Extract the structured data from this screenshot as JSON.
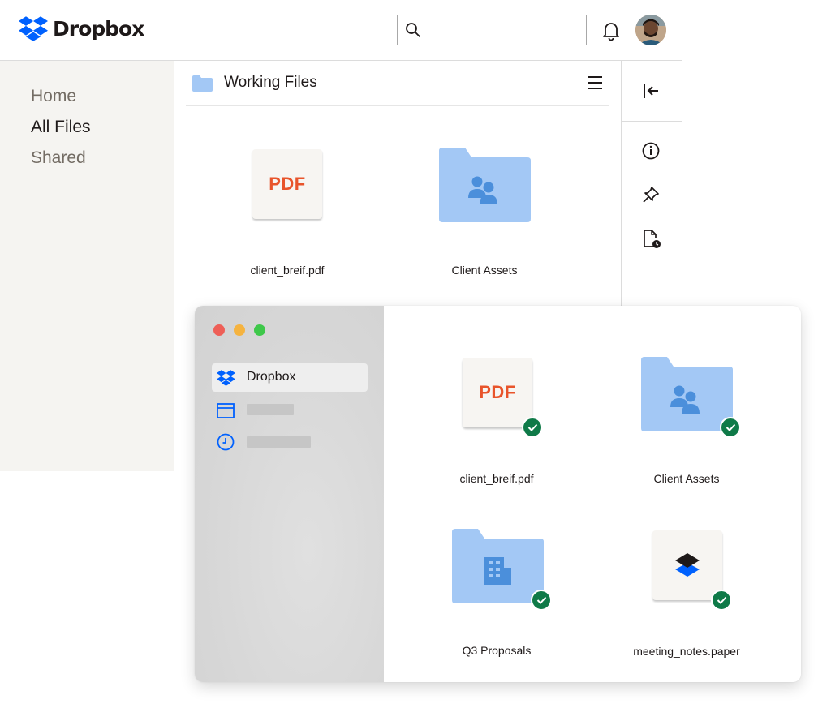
{
  "brand": {
    "name": "Dropbox",
    "color": "#0061fe"
  },
  "header": {
    "search_placeholder": "",
    "bell_icon": "bell-icon",
    "avatar_icon": "user-avatar"
  },
  "sidebar": {
    "items": [
      {
        "label": "Home",
        "active": false
      },
      {
        "label": "All Files",
        "active": true
      },
      {
        "label": "Shared",
        "active": false
      }
    ]
  },
  "main": {
    "folder_title": "Working Files",
    "files": [
      {
        "name": "client_breif.pdf",
        "badge": "PDF",
        "type": "pdf"
      },
      {
        "name": "Client Assets",
        "type": "shared-folder"
      }
    ]
  },
  "rail": {
    "icons": [
      "collapse-panel-icon",
      "info-icon",
      "pin-icon",
      "file-history-icon"
    ]
  },
  "desktop_window": {
    "traffic_lights": [
      "#ee5f57",
      "#f5b33f",
      "#3ec84a"
    ],
    "nav": {
      "active_label": "Dropbox"
    },
    "files": [
      {
        "name": "client_breif.pdf",
        "badge": "PDF",
        "type": "pdf",
        "synced": true
      },
      {
        "name": "Client Assets",
        "type": "shared-folder",
        "synced": true
      },
      {
        "name": "Q3 Proposals",
        "type": "building-folder",
        "synced": true
      },
      {
        "name": "meeting_notes.paper",
        "type": "paper",
        "synced": true
      }
    ],
    "sync_color": "#0f7a48"
  },
  "colors": {
    "folder": "#a3c8f5",
    "folder_glyph": "#4b8fdb",
    "pdf_text": "#e8542b",
    "sidebar_bg": "#f5f4f1"
  }
}
